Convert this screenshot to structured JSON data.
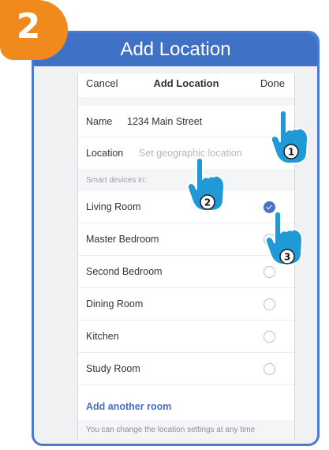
{
  "step_badge": "2",
  "banner": {
    "title": "Add Location"
  },
  "nav": {
    "cancel": "Cancel",
    "title": "Add Location",
    "done": "Done"
  },
  "form": {
    "name_label": "Name",
    "name_value": "1234 Main Street",
    "location_label": "Location",
    "location_placeholder": "Set geographic location"
  },
  "section_label": "Smart devices in:",
  "rooms": [
    {
      "name": "Living Room",
      "selected": true
    },
    {
      "name": "Master Bedroom",
      "selected": false
    },
    {
      "name": "Second Bedroom",
      "selected": false
    },
    {
      "name": "Dining Room",
      "selected": false
    },
    {
      "name": "Kitchen",
      "selected": false
    },
    {
      "name": "Study Room",
      "selected": false
    }
  ],
  "add_room": "Add another room",
  "footer_note": "You can change the location settings at any time",
  "callouts": [
    "1",
    "2",
    "3"
  ],
  "colors": {
    "banner": "#3f71c5",
    "badge": "#f08a1c",
    "hand": "#1f9ad6",
    "check": "#4d6fc4"
  }
}
